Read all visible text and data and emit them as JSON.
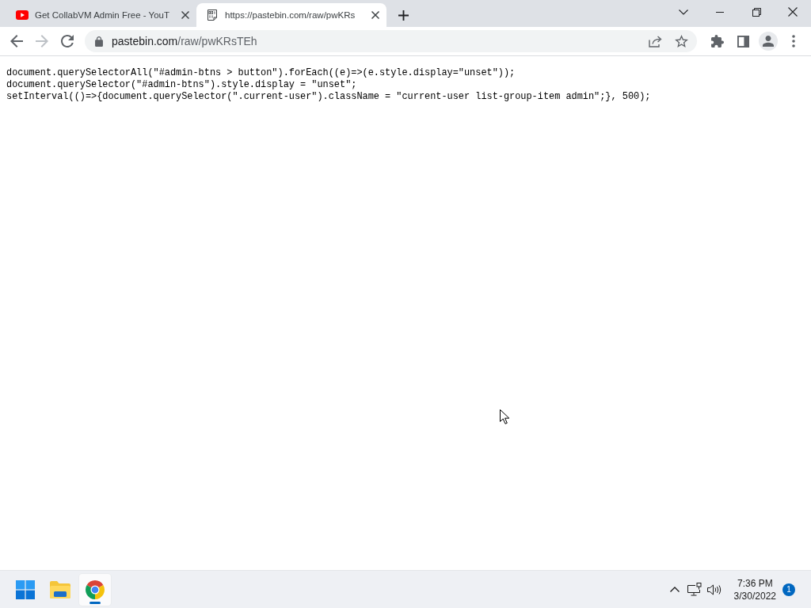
{
  "tabs": [
    {
      "kind": "video",
      "title": "Get CollabVM Admin Free - YouT",
      "selected": false
    },
    {
      "kind": "document",
      "title": "https://pastebin.com/raw/pwKRs",
      "selected": true
    }
  ],
  "toolbar": {
    "nav": [
      {
        "kind": "back",
        "disabled": false
      },
      {
        "kind": "forward",
        "disabled": true
      },
      {
        "kind": "reload",
        "disabled": false
      }
    ],
    "address": "pastebin.com/raw/pwKRsTEh"
  },
  "page": {
    "lines": [
      "document.querySelectorAll(\"#admin-btns > button\").forEach((e)=>(e.style.display=\"unset\"));",
      "document.querySelector(\"#admin-btns\").style.display = \"unset\";",
      "setInterval(()=>{document.querySelector(\".current-user\").className = \"current-user list-group-item admin\";}, 500);"
    ]
  },
  "taskbar": {
    "apps": [
      {
        "kind": "start",
        "active": false
      },
      {
        "kind": "files",
        "active": false
      },
      {
        "kind": "browser",
        "active": true
      }
    ],
    "time": "7:36 PM",
    "date": "3/30/2022",
    "notifications": "1"
  }
}
